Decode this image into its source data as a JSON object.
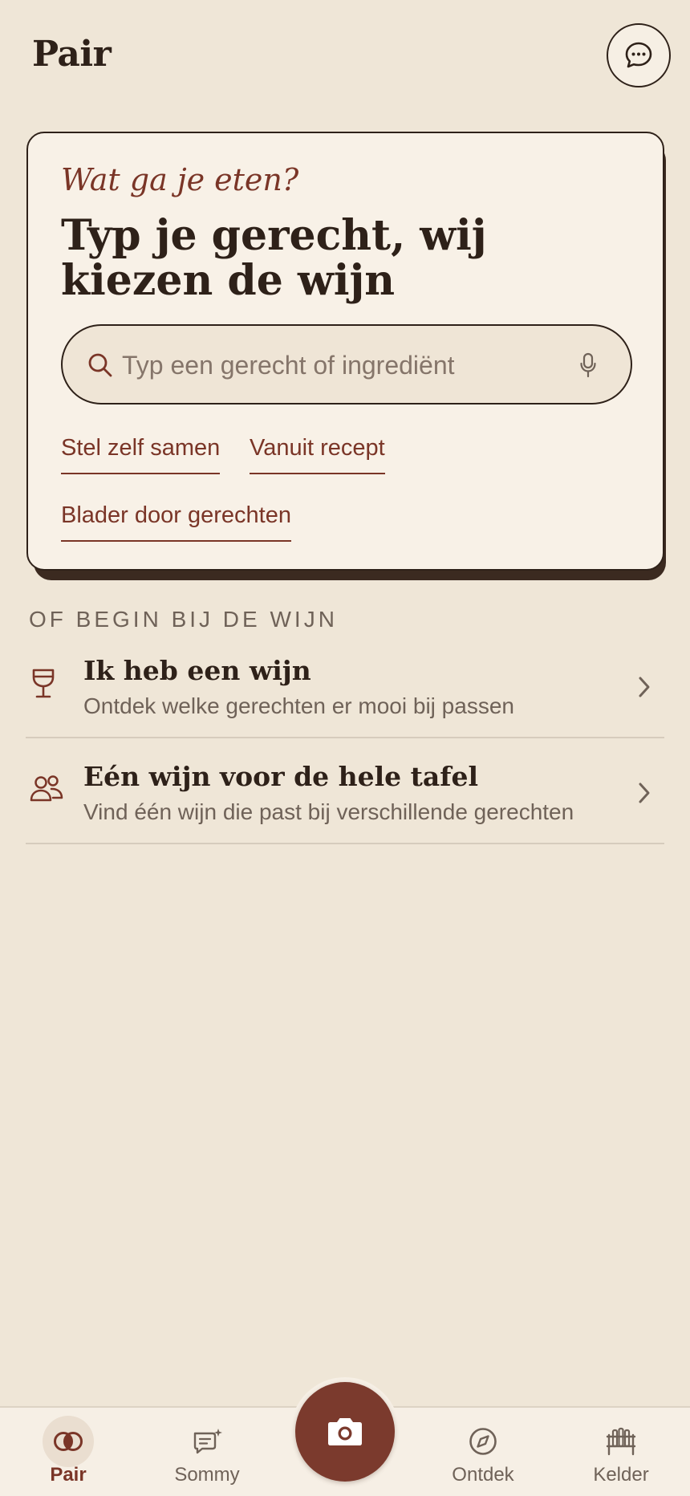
{
  "header": {
    "title": "Pair",
    "chat_icon": "chat-bubble-icon"
  },
  "hero": {
    "kicker": "Wat ga je eten?",
    "title": "Typ je gerecht, wij kiezen de wijn",
    "search": {
      "placeholder": "Typ een gerecht of ingrediënt",
      "value": ""
    },
    "links": [
      {
        "label": "Stel zelf samen"
      },
      {
        "label": "Vanuit recept"
      },
      {
        "label": "Blader door gerechten"
      }
    ]
  },
  "section": {
    "label": "OF BEGIN BIJ DE WIJN",
    "items": [
      {
        "title": "Ik heb een wijn",
        "subtitle": "Ontdek welke gerechten er mooi bij passen",
        "icon": "wine-glass-icon"
      },
      {
        "title": "Eén wijn voor de hele tafel",
        "subtitle": "Vind één wijn die past bij verschillende gerechten",
        "icon": "people-icon"
      }
    ]
  },
  "nav": {
    "items": [
      {
        "label": "Pair",
        "icon": "pair-rings-icon",
        "active": true
      },
      {
        "label": "Sommy",
        "icon": "chat-sparkle-icon",
        "active": false
      },
      {
        "label": "Ontdek",
        "icon": "compass-icon",
        "active": false
      },
      {
        "label": "Kelder",
        "icon": "wine-rack-icon",
        "active": false
      }
    ],
    "camera_icon": "camera-icon"
  },
  "colors": {
    "background": "#efe6d7",
    "card": "#f8f1e7",
    "accent": "#7a3527",
    "text": "#2e2119",
    "muted": "#6f6258"
  }
}
